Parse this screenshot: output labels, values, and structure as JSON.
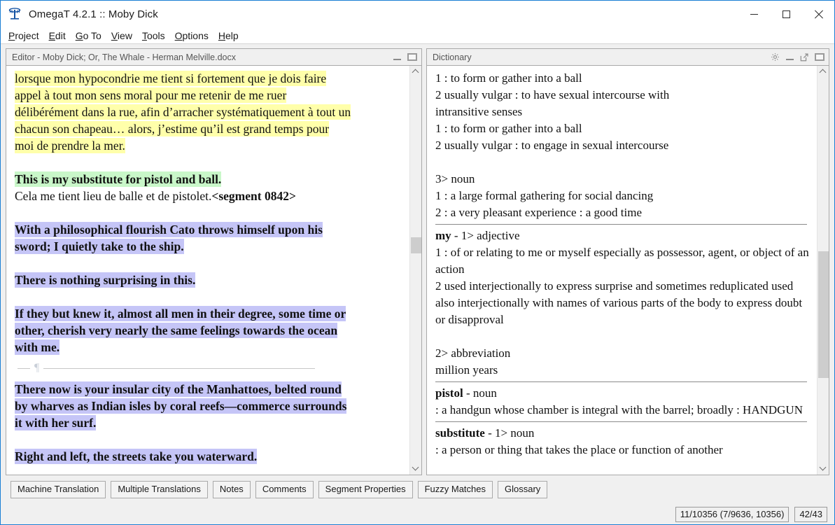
{
  "window": {
    "title": "OmegaT 4.2.1 :: Moby Dick",
    "app_icon": "omegat-logo-icon",
    "controls": {
      "minimize": "minimize-icon",
      "maximize": "maximize-icon",
      "close": "close-icon"
    }
  },
  "menubar": {
    "items": [
      {
        "label": "Project",
        "mnemonic": "P"
      },
      {
        "label": "Edit",
        "mnemonic": "E"
      },
      {
        "label": "Go To",
        "mnemonic": "G"
      },
      {
        "label": "View",
        "mnemonic": "V"
      },
      {
        "label": "Tools",
        "mnemonic": "T"
      },
      {
        "label": "Options",
        "mnemonic": "O"
      },
      {
        "label": "Help",
        "mnemonic": "H"
      }
    ]
  },
  "editor": {
    "title": "Editor - Moby Dick; Or, The Whale - Herman Melville.docx",
    "tools": [
      "minimize-icon",
      "maximize-icon"
    ],
    "scroll": {
      "thumb_top_pct": 41.5,
      "thumb_height_pct": 4.2
    },
    "segments": [
      {
        "id": "seg-french-top",
        "type": "translation",
        "highlight": "yellow",
        "bold": false,
        "lines": [
          "lorsque mon hypocondrie me tient si fortement que je dois faire",
          "appel à tout mon sens moral pour me retenir de me ruer",
          "délibérément dans la rue, afin d’arracher systématiquement à tout un",
          "chacun son chapeau… alors, j’estime qu’il est grand temps pour",
          "moi de prendre la mer."
        ]
      },
      {
        "id": "seg-0842-source",
        "type": "source",
        "highlight": "green",
        "bold": true,
        "lines": [
          "This is my substitute for pistol and ball."
        ]
      },
      {
        "id": "seg-0842-target",
        "type": "target",
        "highlight": "none",
        "bold": false,
        "text": "Cela me tient lieu de balle et de pistolet.",
        "marker": "<segment 0842>"
      },
      {
        "id": "seg-cato",
        "type": "source",
        "highlight": "purple",
        "bold": true,
        "lines": [
          "With a philosophical flourish Cato throws himself upon his",
          "sword; I quietly take to the ship."
        ]
      },
      {
        "id": "seg-nothing-surprising",
        "type": "source",
        "highlight": "purple",
        "bold": true,
        "lines": [
          "There is nothing surprising in this."
        ]
      },
      {
        "id": "seg-if-they-but-knew",
        "type": "source",
        "highlight": "purple",
        "bold": true,
        "lines": [
          "If they but knew it, almost all men in their degree, some time or",
          "other, cherish very nearly the same feelings towards the ocean",
          "with me."
        ]
      },
      {
        "id": "paragraph-separator",
        "type": "separator",
        "glyph": "¶"
      },
      {
        "id": "seg-manhattoes",
        "type": "source",
        "highlight": "purple",
        "bold": true,
        "lines": [
          "There now is your insular city of the Manhattoes, belted round",
          "by wharves as Indian isles by coral reefs—commerce surrounds",
          "it with her surf."
        ]
      },
      {
        "id": "seg-right-and-left",
        "type": "source",
        "highlight": "purple",
        "bold": true,
        "clipped": true,
        "lines": [
          "Right and left, the streets take you waterward."
        ]
      }
    ]
  },
  "dictionary": {
    "title": "Dictionary",
    "tools": [
      "gear-icon",
      "minimize-icon",
      "popout-icon",
      "maximize-icon"
    ],
    "scroll": {
      "thumb_top_pct": 45.0,
      "thumb_height_pct": 33.0
    },
    "blocks": [
      {
        "kind": "line",
        "text": "1 : to form or gather into a ball"
      },
      {
        "kind": "wrap",
        "text": "2 usually vulgar : to have sexual intercourse with"
      },
      {
        "kind": "line",
        "text": "intransitive senses"
      },
      {
        "kind": "line",
        "text": "1 : to form or gather into a ball"
      },
      {
        "kind": "line",
        "text": "2 usually vulgar : to engage in sexual intercourse"
      },
      {
        "kind": "blank"
      },
      {
        "kind": "line",
        "text": "3> noun"
      },
      {
        "kind": "line",
        "text": "1 : a large formal gathering for social dancing"
      },
      {
        "kind": "line",
        "text": "2 : a very pleasant experience : a good time"
      },
      {
        "kind": "hr"
      },
      {
        "kind": "entry",
        "head": "my",
        "rest": " - 1> adjective"
      },
      {
        "kind": "wrap",
        "text": "1 : of or relating to me or myself especially as possessor, agent, or object of an action"
      },
      {
        "kind": "wrap",
        "text": "2 used interjectionally to express surprise and sometimes reduplicated  used also interjectionally with names of various parts of the body to express doubt or disapproval"
      },
      {
        "kind": "blank"
      },
      {
        "kind": "line",
        "text": "2> abbreviation"
      },
      {
        "kind": "line",
        "text": "million years"
      },
      {
        "kind": "hr"
      },
      {
        "kind": "entry",
        "head": "pistol",
        "rest": " - noun"
      },
      {
        "kind": "wrap",
        "text": ": a handgun whose chamber is integral with the barrel; broadly : HANDGUN"
      },
      {
        "kind": "hr"
      },
      {
        "kind": "entry",
        "head": "substitute",
        "rest": " - 1> noun"
      },
      {
        "kind": "wrap",
        "text": ": a person or thing that takes the place or function of another"
      }
    ]
  },
  "tabs": [
    {
      "label": "Machine Translation",
      "active": false
    },
    {
      "label": "Multiple Translations",
      "active": false
    },
    {
      "label": "Notes",
      "active": false
    },
    {
      "label": "Comments",
      "active": false
    },
    {
      "label": "Segment Properties",
      "active": false
    },
    {
      "label": "Fuzzy Matches",
      "active": false
    },
    {
      "label": "Glossary",
      "active": false
    }
  ],
  "statusbar": {
    "progress": "11/10356 (7/9636, 10356)",
    "segment_counter": "42/43"
  },
  "colors": {
    "accent_border": "#1a7fd4",
    "highlight_yellow": "#ffffaa",
    "highlight_green": "#c9f7c9",
    "highlight_purple": "#c5c5f7",
    "panel_bg": "#f0f0f0",
    "text": "#111111"
  }
}
